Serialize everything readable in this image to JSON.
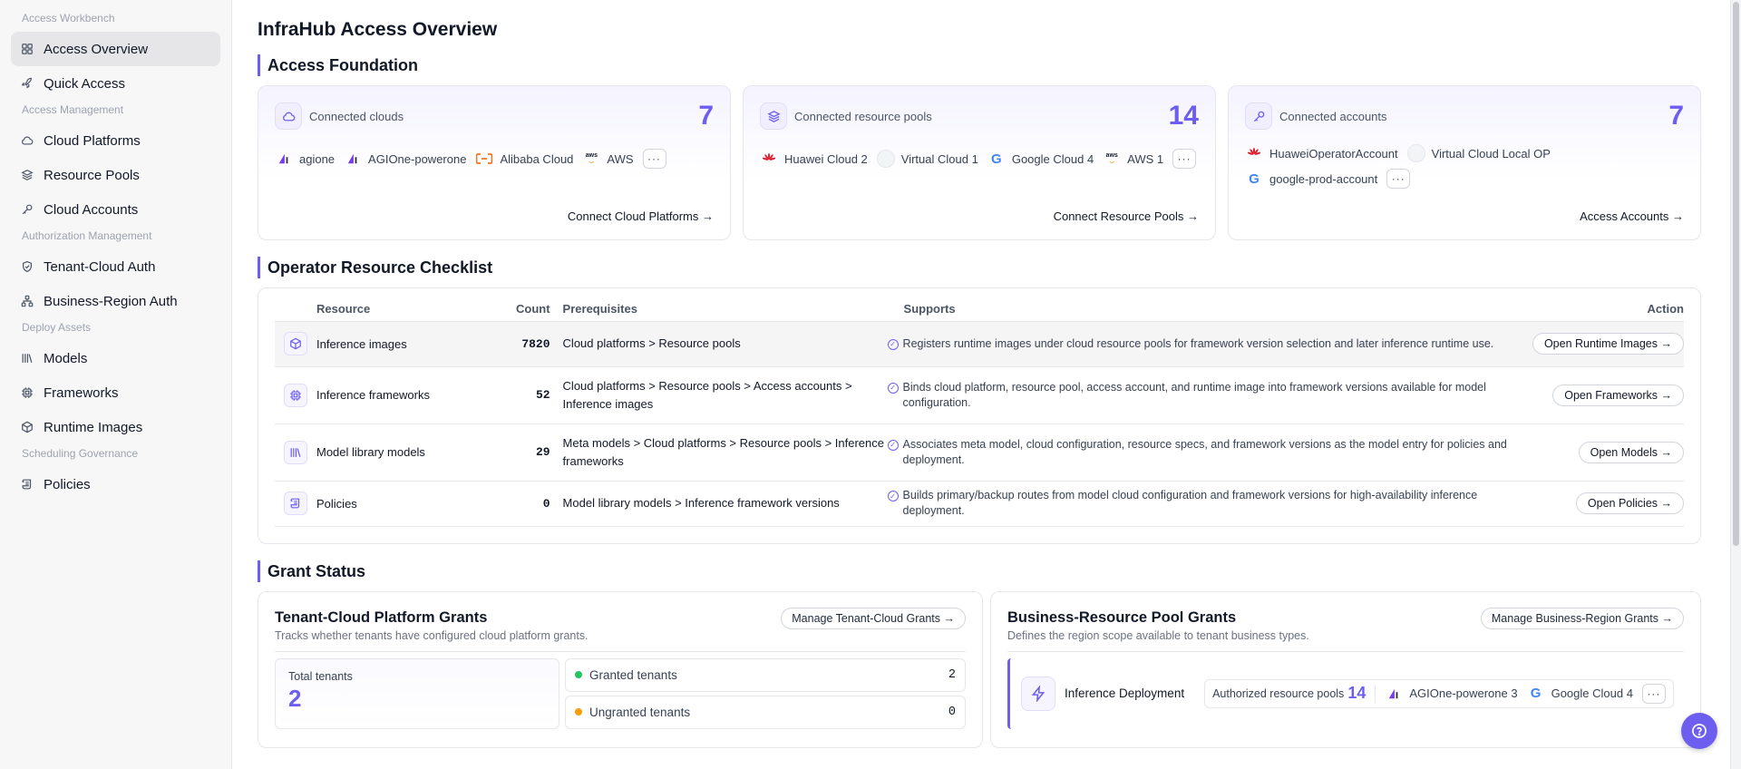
{
  "sidebar": {
    "groups": [
      {
        "label": "Access Workbench",
        "items": [
          {
            "label": "Access Overview",
            "icon": "grid-icon",
            "active": true
          },
          {
            "label": "Quick Access",
            "icon": "rocket-icon"
          }
        ]
      },
      {
        "label": "Access Management",
        "items": [
          {
            "label": "Cloud Platforms",
            "icon": "cloud-icon"
          },
          {
            "label": "Resource Pools",
            "icon": "layers-icon"
          },
          {
            "label": "Cloud Accounts",
            "icon": "key-icon"
          }
        ]
      },
      {
        "label": "Authorization Management",
        "items": [
          {
            "label": "Tenant-Cloud Auth",
            "icon": "shield-icon"
          },
          {
            "label": "Business-Region Auth",
            "icon": "network-icon"
          }
        ]
      },
      {
        "label": "Deploy Assets",
        "items": [
          {
            "label": "Models",
            "icon": "library-icon"
          },
          {
            "label": "Frameworks",
            "icon": "chip-icon"
          },
          {
            "label": "Runtime Images",
            "icon": "box-icon"
          }
        ]
      },
      {
        "label": "Scheduling Governance",
        "items": [
          {
            "label": "Policies",
            "icon": "scroll-icon"
          }
        ]
      }
    ]
  },
  "page": {
    "title": "InfraHub Access Overview"
  },
  "foundation": {
    "title": "Access Foundation",
    "cards": [
      {
        "label": "Connected clouds",
        "count": "7",
        "icon": "cloud-icon",
        "link": "Connect Cloud Platforms →",
        "chips": [
          {
            "label": "agione",
            "logo": "agi"
          },
          {
            "label": "AGIOne-powerone",
            "logo": "agi"
          },
          {
            "label": "Alibaba Cloud",
            "logo": "ali"
          },
          {
            "label": "AWS",
            "logo": "aws"
          }
        ]
      },
      {
        "label": "Connected resource pools",
        "count": "14",
        "icon": "layers-icon",
        "link": "Connect Resource Pools →",
        "chips": [
          {
            "label": "Huawei Cloud 2",
            "logo": "hw"
          },
          {
            "label": "Virtual Cloud 1",
            "logo": "blank"
          },
          {
            "label": "Google Cloud 4",
            "logo": "g"
          },
          {
            "label": "AWS 1",
            "logo": "aws"
          }
        ]
      },
      {
        "label": "Connected accounts",
        "count": "7",
        "icon": "key-icon",
        "link": "Access Accounts →",
        "chips": [
          {
            "label": "HuaweiOperatorAccount",
            "logo": "hw"
          },
          {
            "label": "Virtual Cloud Local OP",
            "logo": "blank"
          },
          {
            "label": "google-prod-account",
            "logo": "g"
          }
        ]
      }
    ],
    "more_label": "···"
  },
  "checklist": {
    "title": "Operator Resource Checklist",
    "headers": {
      "resource": "Resource",
      "count": "Count",
      "prereq": "Prerequisites",
      "supports": "Supports",
      "action": "Action"
    },
    "rows": [
      {
        "icon": "box-icon",
        "name": "Inference images",
        "count": "7820",
        "prereq": "Cloud platforms > Resource pools",
        "supports": "Registers runtime images under cloud resource pools for framework version selection and later inference runtime use.",
        "action": "Open Runtime Images →"
      },
      {
        "icon": "chip-icon",
        "name": "Inference frameworks",
        "count": "52",
        "prereq": "Cloud platforms > Resource pools > Access accounts > Inference images",
        "supports": "Binds cloud platform, resource pool, access account, and runtime image into framework versions available for model configuration.",
        "action": "Open Frameworks →"
      },
      {
        "icon": "library-icon",
        "name": "Model library models",
        "count": "29",
        "prereq": "Meta models > Cloud platforms > Resource pools > Inference frameworks",
        "supports": "Associates meta model, cloud configuration, resource specs, and framework versions as the model entry for policies and deployment.",
        "action": "Open Models →"
      },
      {
        "icon": "scroll-icon",
        "name": "Policies",
        "count": "0",
        "prereq": "Model library models > Inference framework versions",
        "supports": "Builds primary/backup routes from model cloud configuration and framework versions for high-availability inference deployment.",
        "action": "Open Policies →"
      }
    ]
  },
  "grants": {
    "title": "Grant Status",
    "tenant": {
      "title": "Tenant-Cloud Platform Grants",
      "subtitle": "Tracks whether tenants have configured cloud platform grants.",
      "button": "Manage Tenant-Cloud Grants →",
      "total_label": "Total tenants",
      "total_value": "2",
      "granted_label": "Granted tenants",
      "granted_value": "2",
      "ungranted_label": "Ungranted tenants",
      "ungranted_value": "0",
      "colors": {
        "granted": "#22c55e",
        "ungranted": "#f59e0b"
      }
    },
    "business": {
      "title": "Business-Resource Pool Grants",
      "subtitle": "Defines the region scope available to tenant business types.",
      "button": "Manage Business-Region Grants →",
      "deploy_name": "Inference Deployment",
      "pool_label": "Authorized resource pools",
      "pool_value": "14",
      "pools": [
        {
          "label": "AGIOne-powerone 3",
          "logo": "agi"
        },
        {
          "label": "Google Cloud 4",
          "logo": "g"
        }
      ],
      "more_label": "···"
    }
  },
  "colors": {
    "accent": "#6d5ef0"
  }
}
